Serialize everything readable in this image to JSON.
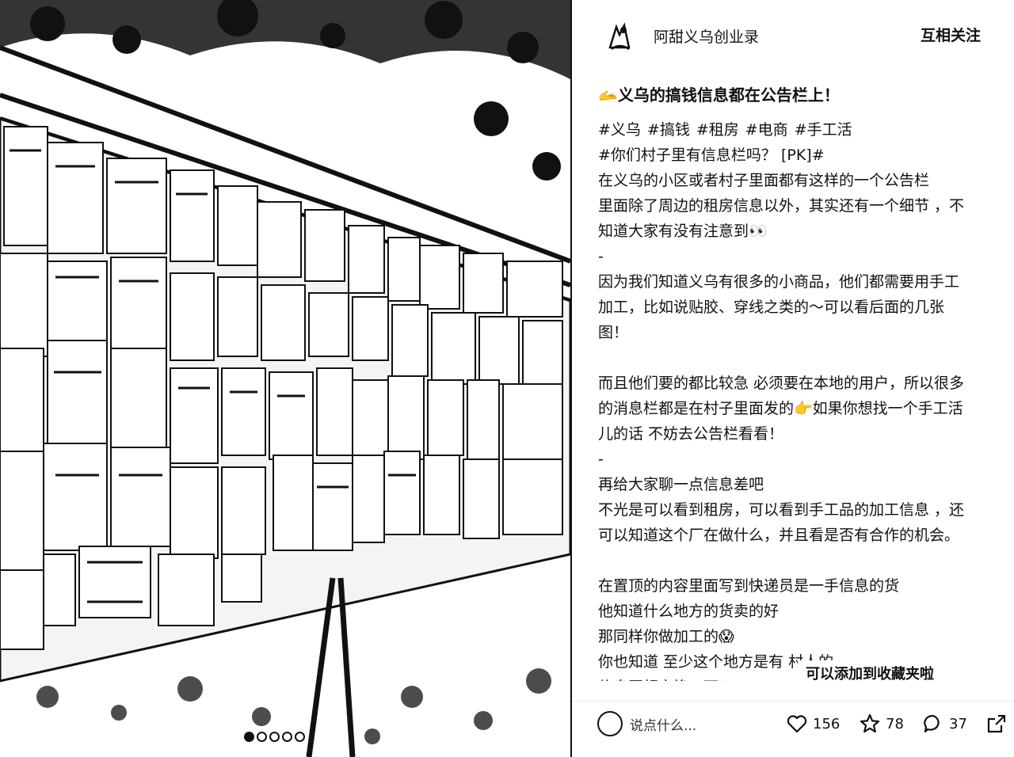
{
  "photo": {
    "description_icon": "bulletin-board-photo",
    "carousel_pages": 5,
    "carousel_active_index": 0
  },
  "author": {
    "name": "阿甜义乌创业录",
    "follow_label": "互相关注"
  },
  "note": {
    "title": "🫴义乌的搞钱信息都在公告栏上！",
    "tags": [
      "#义乌",
      "#搞钱",
      "#租房",
      "#电商",
      "#手工活"
    ],
    "lines": [
      "#你们村子里有信息栏吗？ [PK]#",
      "在义乌的小区或者村子里面都有这样的一个公告栏",
      "里面除了周边的租房信息以外，其实还有一个细节 ，不",
      "知道大家有没有注意到👀",
      "-",
      "因为我们知道义乌有很多的小商品，他们都需要用手工",
      "加工，比如说贴胶、穿线之类的～可以看后面的几张",
      "图！",
      "",
      "而且他们要的都比较急 必须要在本地的用户，所以很多",
      "的消息栏都是在村子里面发的👉如果你想找一个手工活",
      "儿的话 不妨去公告栏看看！",
      "-",
      "再给大家聊一点信息差吧",
      "不光是可以看到租房，可以看到手工品的加工信息 ，还",
      "可以知道这个厂在做什么，并且看是否有合作的机会。",
      "",
      "在置顶的内容里面写到快递员是一手信息的货",
      "他知道什么地方的货卖的好",
      "那同样你做加工的😱",
      "你也知道 至少这个地方是有                      村人的",
      "信息互相交换一下！"
    ]
  },
  "toast": {
    "text": "可以添加到收藏夹啦"
  },
  "actions": {
    "comment_placeholder": "说点什么...",
    "likes": "156",
    "collects": "78",
    "comments": "37"
  },
  "icons": {
    "like": "heart-icon",
    "collect": "star-icon",
    "comment": "comment-bubble-icon",
    "share": "share-icon"
  }
}
